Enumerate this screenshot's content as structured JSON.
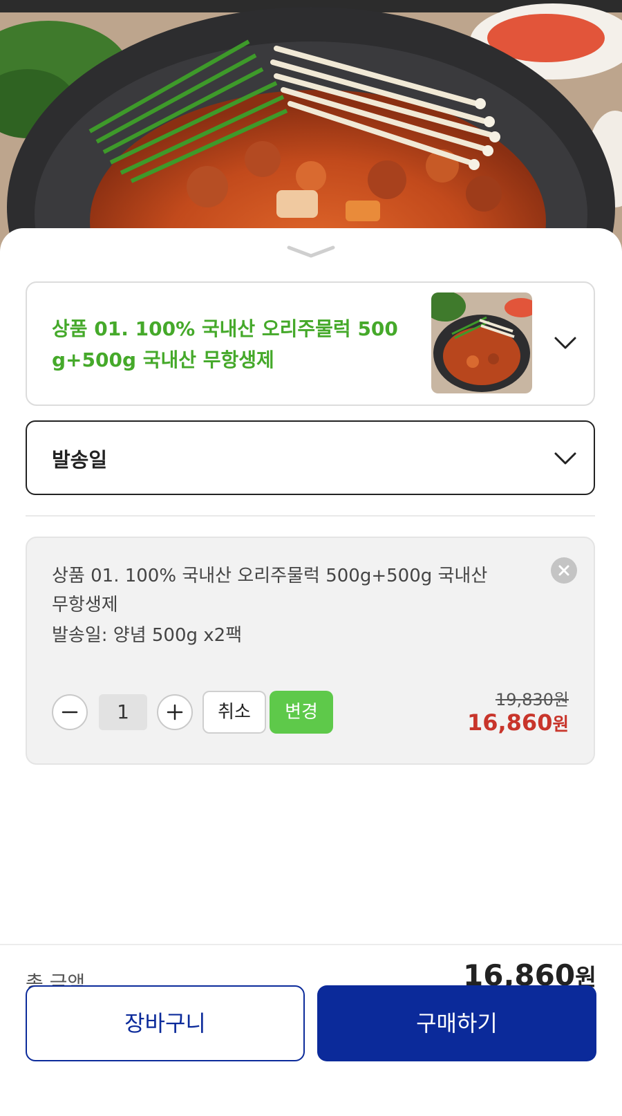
{
  "product_selector": {
    "title": "상품 01. 100% 국내산 오리주물럭 500g+500g 국내산 무항생제",
    "accent_color": "#45a92a"
  },
  "ship_date_selector": {
    "label": "발송일"
  },
  "selected_option": {
    "name": "상품 01. 100% 국내산 오리주물럭 500g+500g 국내산 무항생제",
    "detail": "발송일: 양념 500g x2팩",
    "quantity": "1",
    "cancel_label": "취소",
    "change_label": "변경",
    "original_price": "19,830원",
    "sale_price": "16,860",
    "sale_price_unit": "원"
  },
  "summary": {
    "total_label": "총 금액",
    "total_amount": "16,860",
    "total_unit": "원"
  },
  "actions": {
    "cart_label": "장바구니",
    "buy_label": "구매하기"
  },
  "colors": {
    "brand": "#0b2a9a",
    "change_button": "#5ec94a",
    "sale_price": "#c8352b"
  },
  "icons": {
    "sheet_handle": "chevron-down-icon",
    "dropdown": "chevron-down-icon",
    "remove": "close-icon",
    "decrement": "minus-icon",
    "increment": "plus-icon"
  }
}
